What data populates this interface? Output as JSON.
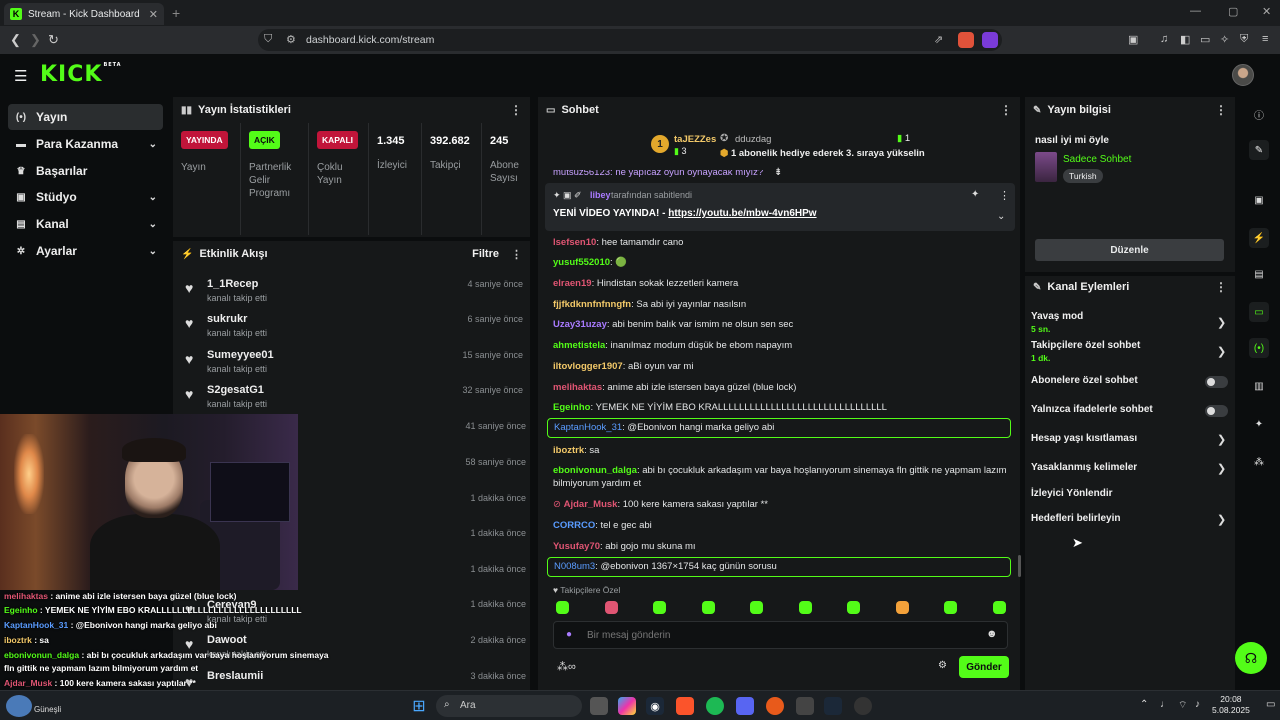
{
  "browser": {
    "tab_title": "Stream - Kick Dashboard",
    "tab_favicon": "K",
    "url": "dashboard.kick.com/stream"
  },
  "header": {
    "logo": "KICK",
    "logo_badge": "BETA"
  },
  "sidebar": {
    "items": [
      {
        "label": "Yayın",
        "icon": "broadcast-icon",
        "glyph": "(•)",
        "chevron": false,
        "active": true
      },
      {
        "label": "Para Kazanma",
        "icon": "money-icon",
        "glyph": "▬",
        "chevron": true,
        "active": false
      },
      {
        "label": "Başarılar",
        "icon": "trophy-icon",
        "glyph": "♛",
        "chevron": false,
        "active": false
      },
      {
        "label": "Stüdyo",
        "icon": "studio-icon",
        "glyph": "▣",
        "chevron": true,
        "active": false
      },
      {
        "label": "Kanal",
        "icon": "channel-icon",
        "glyph": "▤",
        "chevron": true,
        "active": false
      },
      {
        "label": "Ayarlar",
        "icon": "settings-icon",
        "glyph": "✲",
        "chevron": true,
        "active": false
      }
    ]
  },
  "stats": {
    "title": "Yayın İstatistikleri",
    "items": [
      {
        "badge": "YAYINDA",
        "label": "Yayın"
      },
      {
        "badge": "AÇIK",
        "label": "Partnerlik Gelir Programı"
      },
      {
        "badge": "KAPALI",
        "label": "Çoklu Yayın"
      },
      {
        "value": "1.345",
        "label": "İzleyici"
      },
      {
        "value": "392.682",
        "label": "Takipçi"
      },
      {
        "value": "245",
        "label": "Abone Sayısı"
      }
    ]
  },
  "activity": {
    "title": "Etkinlik Akışı",
    "filter": "Filtre",
    "items": [
      {
        "name": "1_1Recep",
        "desc": "kanalı takip etti",
        "time": "4 saniye önce"
      },
      {
        "name": "sukrukr",
        "desc": "kanalı takip etti",
        "time": "6 saniye önce"
      },
      {
        "name": "Sumeyyee01",
        "desc": "kanalı takip etti",
        "time": "15 saniye önce"
      },
      {
        "name": "S2gesatG1",
        "desc": "kanalı takip etti",
        "time": "32 saniye önce"
      }
    ],
    "times_more": [
      "41 saniye önce",
      "58 saniye önce",
      "1 dakika önce",
      "1 dakika önce",
      "1 dakika önce",
      "1 dakika önce",
      "2 dakika önce",
      "3 dakika önce"
    ],
    "bottom_items": [
      {
        "name": "Cerevan9",
        "desc": "kanalı takip etti"
      },
      {
        "name": "Dawoot",
        "desc": "kanalı takip etti"
      },
      {
        "name": "Breslaumii",
        "desc": ""
      }
    ]
  },
  "chat": {
    "title": "Sohbet",
    "top_gifter": {
      "name": "taJEZZes",
      "count": "3",
      "rank": "1"
    },
    "gift_user": "dduzdag",
    "gift_count": "1",
    "gift_text": "1 abonelik hediye ederek 3. sıraya yükselin",
    "cut_line": "mutsuz56123: ne yapıcaz oyun oynayacak mıyız?",
    "pinned_by": "libey",
    "pinned_by_suffix": "tarafından sabitlendi",
    "pinned_msg": "YENİ VİDEO YAYINDA! - ",
    "pinned_link": "https://youtu.be/mbw-4vn6HPw",
    "messages": [
      {
        "user": "lsefsen10",
        "color": "#e05573",
        "text": ": hee tamamdır cano"
      },
      {
        "user": "yusuf552010",
        "color": "#53fc18",
        "text": ": 🟢"
      },
      {
        "user": "elraen19",
        "color": "#e05573",
        "text": ": Hindistan sokak lezzetleri kamera"
      },
      {
        "user": "fjjfkdknnfnfnngfn",
        "color": "#f3c969",
        "text": ": Sa abi iyi yayınlar nasılsın"
      },
      {
        "user": "Uzay31uzay",
        "color": "#a97bff",
        "text": ": abi benim balık var ismim ne olsun sen sec"
      },
      {
        "user": "ahmetistela",
        "color": "#53fc18",
        "text": ": inanılmaz modum düşük be ebom napayım"
      },
      {
        "user": "iltovlogger1907",
        "color": "#f3c969",
        "text": ": aBi oyun var mi"
      },
      {
        "user": "melihaktas",
        "color": "#e05573",
        "text": ": anime abi izle istersen baya güzel (blue lock)"
      },
      {
        "user": "Egeinho",
        "color": "#53fc18",
        "text": ": YEMEK NE YİYİM EBO KRALLLLLLLLLLLLLLLLLLLLLLLLLLLLLLLL"
      },
      {
        "user": "KaptanHook_31",
        "color": "#5a9cff",
        "text": ": @Ebonivon hangi marka geliyo abi",
        "boxed": true
      },
      {
        "user": "iboztrk",
        "color": "#f3c969",
        "text": ": sa"
      },
      {
        "user": "ebonivonun_dalga",
        "color": "#53fc18",
        "text": ": abi bı çocukluk arkadaşım var baya hoşlanıyorum sinemaya fln gittik ne yapmam lazım bilmiyorum yardım et"
      },
      {
        "user": "Ajdar_Musk",
        "color": "#e05573",
        "text": ": 100 kere kamera sakası yaptılar **"
      },
      {
        "user": "CORRCO",
        "color": "#5a9cff",
        "text": ": tel e gec abi"
      },
      {
        "user": "Yusufay70",
        "color": "#e05573",
        "text": ": abi gojo mu skuna mı"
      },
      {
        "user": "N008um3",
        "color": "#5a9cff",
        "text": ": @ebonivon 1367×1754 kaç günün sorusu",
        "boxed": true
      }
    ],
    "emote_section": "Takipçilere Özel",
    "input_placeholder": "Bir mesaj gönderin",
    "send": "Gönder"
  },
  "stream_info": {
    "title": "Yayın bilgisi",
    "stream_title": "nasıl iyi mi öyle",
    "category": "Sadece Sohbet",
    "tag": "Turkish",
    "edit": "Düzenle"
  },
  "channel_actions": {
    "title": "Kanal Eylemleri",
    "items": [
      {
        "label": "Yavaş mod",
        "sub": "5 sn.",
        "control": "chevron"
      },
      {
        "label": "Takipçilere özel sohbet",
        "sub": "1 dk.",
        "control": "chevron"
      },
      {
        "label": "Abonelere özel sohbet",
        "sub": "",
        "control": "toggle"
      },
      {
        "label": "Yalnızca ifadelerle sohbet",
        "sub": "",
        "control": "toggle"
      },
      {
        "label": "Hesap yaşı kısıtlaması",
        "sub": "",
        "control": "chevron"
      },
      {
        "label": "Yasaklanmış kelimeler",
        "sub": "",
        "control": "chevron"
      },
      {
        "label": "İzleyici Yönlendir",
        "sub": "",
        "control": "none"
      },
      {
        "label": "Hedefleri belirleyin",
        "sub": "",
        "control": "chevron"
      }
    ]
  },
  "overlay_chat": [
    {
      "user": "melihaktas",
      "color": "#e05573",
      "text": " : anime abi izle istersen baya güzel (blue lock)"
    },
    {
      "user": "Egeinho",
      "color": "#53fc18",
      "text": " : YEMEK NE YİYİM EBO KRALLLLLLLLLLLLLLLLLLLLLLLLLLLL"
    },
    {
      "user": "KaptanHook_31",
      "color": "#5a9cff",
      "text": " : @Ebonivon hangi marka geliyo abi"
    },
    {
      "user": "iboztrk",
      "color": "#f3c969",
      "text": " : sa"
    },
    {
      "user": "ebonivonun_dalga",
      "color": "#53fc18",
      "text": " : abi bı çocukluk arkadaşım var baya hoşlanıyorum sinemaya"
    },
    {
      "user": "",
      "color": "#fff",
      "text": "fln gittik ne yapmam lazım bilmiyorum yardım et"
    },
    {
      "user": "Ajdar_Musk",
      "color": "#e05573",
      "text": " : 100 kere kamera sakası yaptılar **"
    },
    {
      "user": "CORRCO",
      "color": "#5a9cff",
      "text": " : tel e gec abi"
    },
    {
      "user": "",
      "color": "#fff",
      "text": "mu skuna mi"
    }
  ],
  "taskbar": {
    "search": "Ara",
    "weather": "Güneşli",
    "time": "20:08",
    "date": "5.08.2025"
  }
}
